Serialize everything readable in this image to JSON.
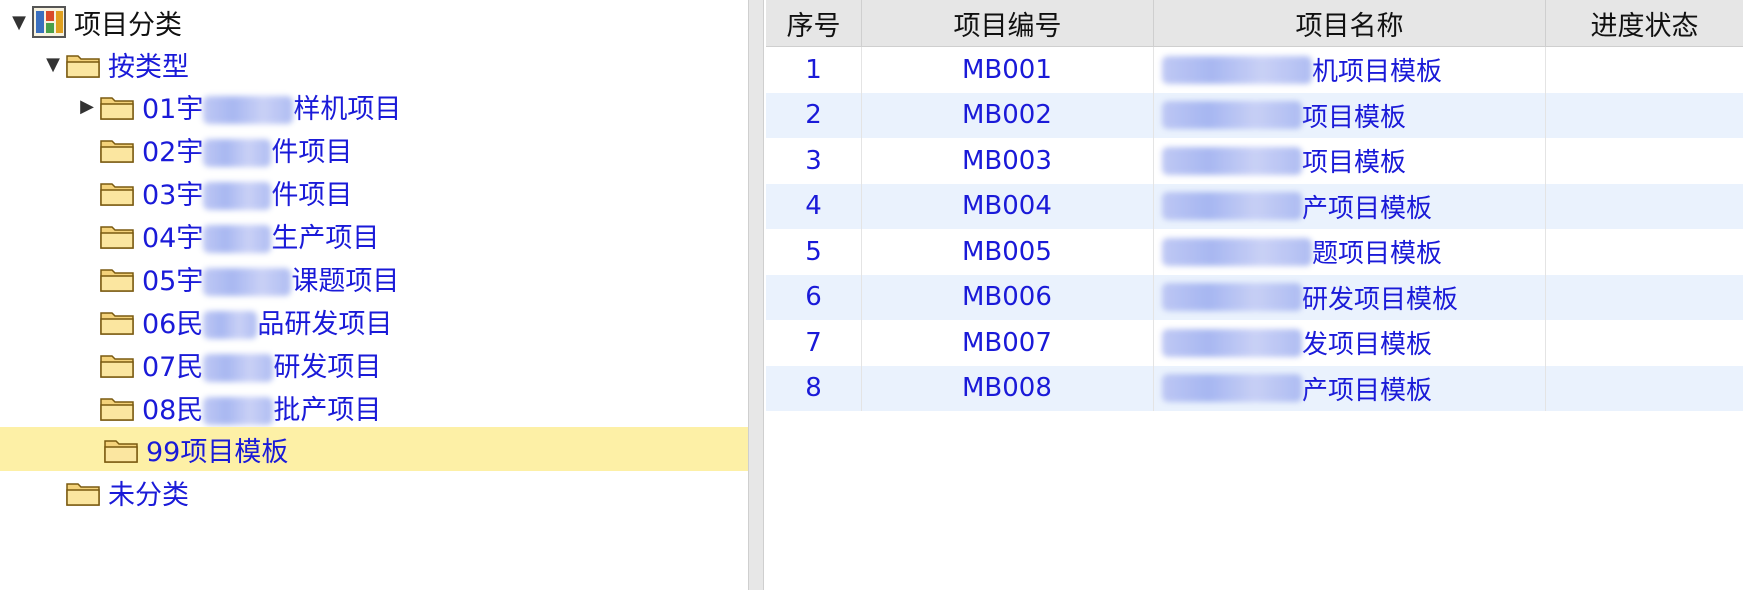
{
  "tree": {
    "root": {
      "label": "项目分类"
    },
    "by_type": {
      "label": "按类型"
    },
    "items": [
      {
        "prefix": "01宇",
        "suffix": "样机项目",
        "has_children": true
      },
      {
        "prefix": "02宇",
        "suffix": "件项目",
        "has_children": false
      },
      {
        "prefix": "03宇",
        "suffix": "件项目",
        "has_children": false
      },
      {
        "prefix": "04宇",
        "suffix": "生产项目",
        "has_children": false
      },
      {
        "prefix": "05宇",
        "suffix": "课题项目",
        "has_children": false
      },
      {
        "prefix": "06民",
        "suffix": "品研发项目",
        "has_children": false
      },
      {
        "prefix": "07民",
        "suffix": "研发项目",
        "has_children": false
      },
      {
        "prefix": "08民",
        "suffix": "批产项目",
        "has_children": false
      }
    ],
    "selected": {
      "label": "99项目模板"
    },
    "uncategorized": {
      "label": "未分类"
    }
  },
  "grid": {
    "columns": [
      "序号",
      "项目编号",
      "项目名称",
      "进度状态"
    ],
    "rows": [
      {
        "no": "1",
        "code": "MB001",
        "name_visible": "机项目模板",
        "status": ""
      },
      {
        "no": "2",
        "code": "MB002",
        "name_visible": "项目模板",
        "status": ""
      },
      {
        "no": "3",
        "code": "MB003",
        "name_visible": "项目模板",
        "status": ""
      },
      {
        "no": "4",
        "code": "MB004",
        "name_visible": "产项目模板",
        "status": ""
      },
      {
        "no": "5",
        "code": "MB005",
        "name_visible": "题项目模板",
        "status": ""
      },
      {
        "no": "6",
        "code": "MB006",
        "name_visible": "研发项目模板",
        "status": ""
      },
      {
        "no": "7",
        "code": "MB007",
        "name_visible": "发项目模板",
        "status": ""
      },
      {
        "no": "8",
        "code": "MB008",
        "name_visible": "产项目模板",
        "status": ""
      }
    ]
  },
  "colors": {
    "selected_bg": "#fdf0a6",
    "link": "#1a1ad8",
    "alt_row": "#eaf2fd",
    "header_bg": "#e6e6e6"
  }
}
